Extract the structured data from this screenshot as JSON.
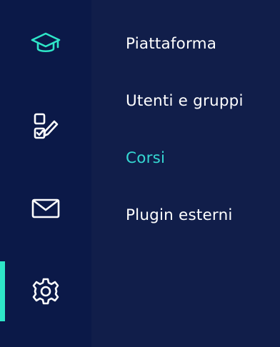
{
  "nav": {
    "icons": [
      {
        "name": "graduation-cap-icon",
        "color": "#2ee6c8"
      },
      {
        "name": "checklist-edit-icon",
        "color": "#ffffff"
      },
      {
        "name": "mail-icon",
        "color": "#ffffff"
      },
      {
        "name": "gear-icon",
        "color": "#ffffff"
      }
    ],
    "active_icon": "gear-icon",
    "accent_color": "#2ee6c8"
  },
  "menu": {
    "items": [
      {
        "label": "Piattaforma"
      },
      {
        "label": "Utenti e gruppi"
      },
      {
        "label": "Corsi",
        "active": true
      },
      {
        "label": "Plugin esterni"
      }
    ],
    "active_color": "#35d9d3"
  }
}
